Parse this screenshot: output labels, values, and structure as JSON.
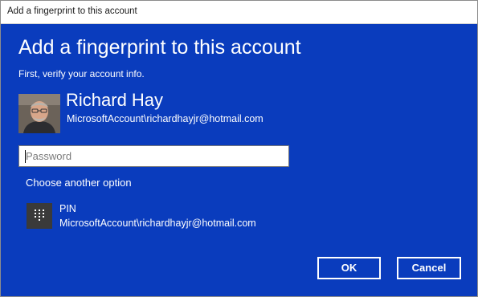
{
  "window": {
    "title": "Add a fingerprint to this account"
  },
  "dialog": {
    "heading": "Add a fingerprint to this account",
    "subtitle": "First, verify your account info."
  },
  "user": {
    "name": "Richard Hay",
    "account": "MicrosoftAccount\\richardhayjr@hotmail.com"
  },
  "password": {
    "placeholder": "Password",
    "value": ""
  },
  "choose_option_label": "Choose another option",
  "option": {
    "icon": "pin-keypad-icon",
    "title": "PIN",
    "account": "MicrosoftAccount\\richardhayjr@hotmail.com"
  },
  "buttons": {
    "ok_label": "OK",
    "cancel_label": "Cancel"
  },
  "colors": {
    "background": "#0a3cbd",
    "text": "#ffffff",
    "tile": "#3a3a3a"
  }
}
